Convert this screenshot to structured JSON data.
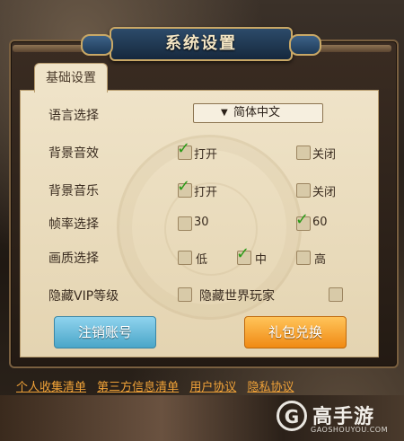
{
  "dialog": {
    "title": "系统设置",
    "tab": "基础设置"
  },
  "settings": {
    "language": {
      "label": "语言选择",
      "selected": "简体中文"
    },
    "sound_effects": {
      "label": "背景音效",
      "on": "打开",
      "off": "关闭",
      "on_checked": true,
      "off_checked": false
    },
    "music": {
      "label": "背景音乐",
      "on": "打开",
      "off": "关闭",
      "on_checked": true,
      "off_checked": false
    },
    "framerate": {
      "label": "帧率选择",
      "opt1": "30",
      "opt2": "60",
      "opt1_checked": false,
      "opt2_checked": true
    },
    "quality": {
      "label": "画质选择",
      "low": "低",
      "mid": "中",
      "high": "高",
      "low_checked": false,
      "mid_checked": true,
      "high_checked": false
    },
    "hide_vip": {
      "label": "隐藏VIP等级",
      "checked": false
    },
    "hide_players": {
      "label": "隐藏世界玩家",
      "checked": false
    }
  },
  "buttons": {
    "logout": "注销账号",
    "gift": "礼包兑换"
  },
  "links": [
    "个人收集清单",
    "第三方信息清单",
    "用户协议",
    "隐私协议"
  ],
  "brand": {
    "logo": "G",
    "name": "高手游",
    "url": "GAOSHOUYOU.COM"
  },
  "colors": {
    "check": "#2a9a18",
    "link": "#f0a238",
    "btn_blue": "#4aa6c8",
    "btn_orange": "#f08a14"
  }
}
